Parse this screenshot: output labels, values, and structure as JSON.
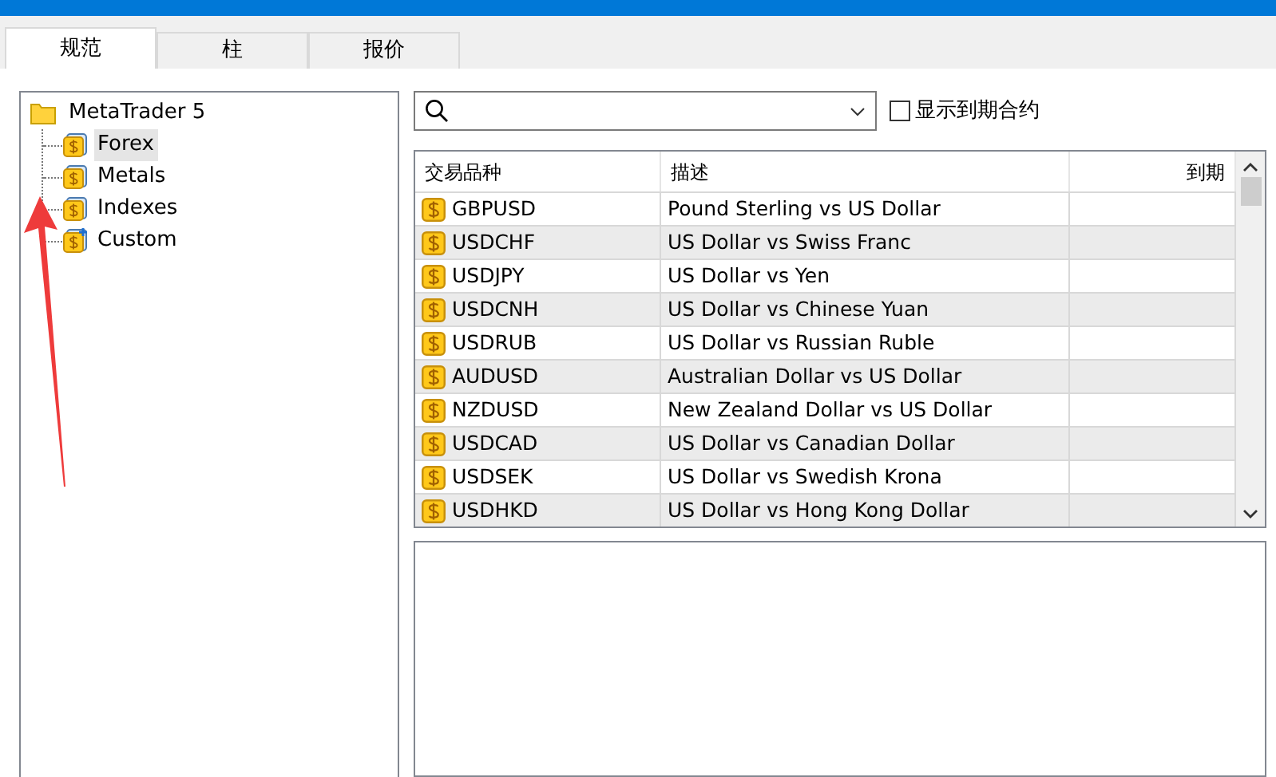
{
  "tabs": [
    {
      "label": "规范",
      "selected": true
    },
    {
      "label": "柱",
      "selected": false
    },
    {
      "label": "报价",
      "selected": false
    }
  ],
  "tree": {
    "label": "MetaTrader 5",
    "children": [
      {
        "label": "Forex",
        "selected": true,
        "kind": "group"
      },
      {
        "label": "Metals",
        "selected": false,
        "kind": "group"
      },
      {
        "label": "Indexes",
        "selected": false,
        "kind": "group"
      },
      {
        "label": "Custom",
        "selected": false,
        "kind": "custom"
      }
    ]
  },
  "show_expired": {
    "label": "显示到期合约",
    "checked": false
  },
  "table": {
    "columns": [
      "交易品种",
      "描述",
      "到期"
    ],
    "rows": [
      [
        "GBPUSD",
        "Pound Sterling vs US Dollar",
        ""
      ],
      [
        "USDCHF",
        "US Dollar vs Swiss Franc",
        ""
      ],
      [
        "USDJPY",
        "US Dollar vs Yen",
        ""
      ],
      [
        "USDCNH",
        "US Dollar vs Chinese Yuan",
        ""
      ],
      [
        "USDRUB",
        "US Dollar vs Russian Ruble",
        ""
      ],
      [
        "AUDUSD",
        "Australian Dollar vs US Dollar",
        ""
      ],
      [
        "NZDUSD",
        "New Zealand Dollar vs US Dollar",
        ""
      ],
      [
        "USDCAD",
        "US Dollar vs Canadian Dollar",
        ""
      ],
      [
        "USDSEK",
        "US Dollar vs Swedish Krona",
        ""
      ],
      [
        "USDHKD",
        "US Dollar vs Hong Kong Dollar",
        ""
      ]
    ]
  }
}
